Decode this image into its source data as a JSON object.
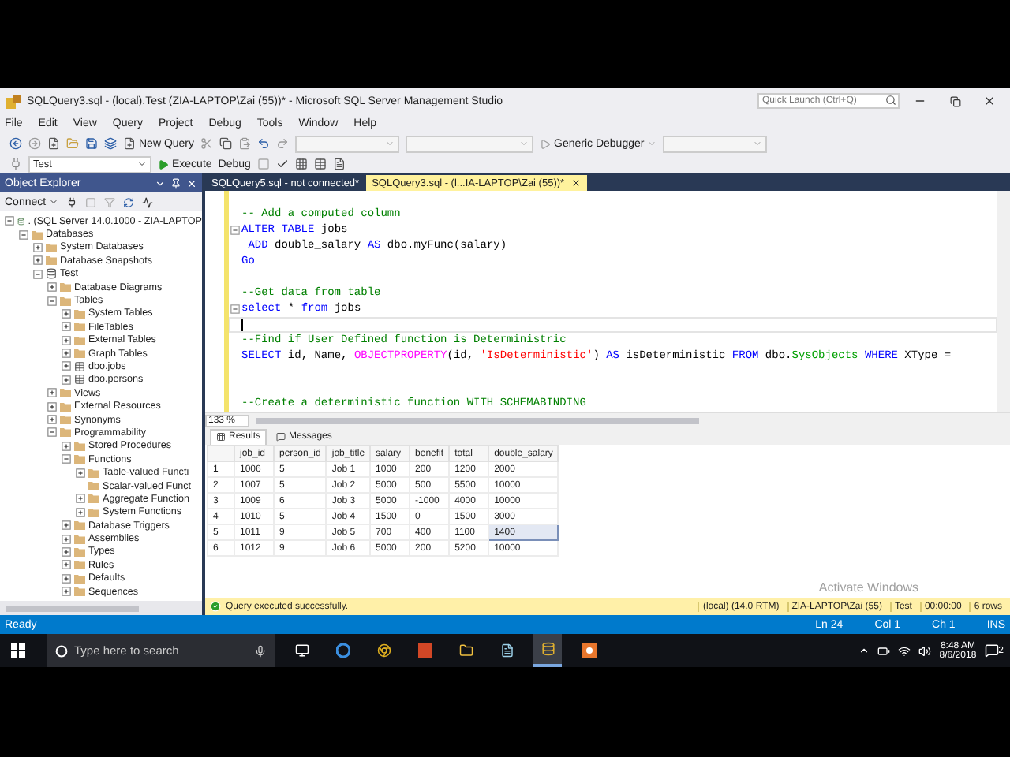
{
  "window": {
    "title": "SQLQuery3.sql - (local).Test (ZIA-LAPTOP\\Zai (55))* - Microsoft SQL Server Management Studio"
  },
  "quick_launch": {
    "placeholder": "Quick Launch (Ctrl+Q)"
  },
  "menu": [
    "File",
    "Edit",
    "View",
    "Query",
    "Project",
    "Debug",
    "Tools",
    "Window",
    "Help"
  ],
  "toolbar": {
    "new_query": "New Query",
    "debugger": "Generic Debugger",
    "database": "Test",
    "execute": "Execute",
    "debug": "Debug"
  },
  "object_explorer": {
    "title": "Object Explorer",
    "connect": "Connect",
    "tree": [
      {
        "label": ". (SQL Server 14.0.1000 - ZIA-LAPTOP",
        "kind": "server",
        "expanded": true,
        "children": [
          {
            "label": "Databases",
            "kind": "folder",
            "expanded": true,
            "children": [
              {
                "label": "System Databases",
                "kind": "folder",
                "expanded": false
              },
              {
                "label": "Database Snapshots",
                "kind": "folder",
                "expanded": false
              },
              {
                "label": "Test",
                "kind": "database",
                "expanded": true,
                "children": [
                  {
                    "label": "Database Diagrams",
                    "kind": "folder",
                    "expanded": false
                  },
                  {
                    "label": "Tables",
                    "kind": "folder",
                    "expanded": true,
                    "children": [
                      {
                        "label": "System Tables",
                        "kind": "folder",
                        "expanded": false
                      },
                      {
                        "label": "FileTables",
                        "kind": "folder",
                        "expanded": false
                      },
                      {
                        "label": "External Tables",
                        "kind": "folder",
                        "expanded": false
                      },
                      {
                        "label": "Graph Tables",
                        "kind": "folder",
                        "expanded": false
                      },
                      {
                        "label": "dbo.jobs",
                        "kind": "table",
                        "expanded": false
                      },
                      {
                        "label": "dbo.persons",
                        "kind": "table",
                        "expanded": false
                      }
                    ]
                  },
                  {
                    "label": "Views",
                    "kind": "folder",
                    "expanded": false
                  },
                  {
                    "label": "External Resources",
                    "kind": "folder",
                    "expanded": false
                  },
                  {
                    "label": "Synonyms",
                    "kind": "folder",
                    "expanded": false
                  },
                  {
                    "label": "Programmability",
                    "kind": "folder",
                    "expanded": true,
                    "children": [
                      {
                        "label": "Stored Procedures",
                        "kind": "folder",
                        "expanded": false
                      },
                      {
                        "label": "Functions",
                        "kind": "folder",
                        "expanded": true,
                        "children": [
                          {
                            "label": "Table-valued Functi",
                            "kind": "folder",
                            "expanded": false
                          },
                          {
                            "label": "Scalar-valued Funct",
                            "kind": "folder"
                          },
                          {
                            "label": "Aggregate Function",
                            "kind": "folder",
                            "expanded": false
                          },
                          {
                            "label": "System Functions",
                            "kind": "folder",
                            "expanded": false
                          }
                        ]
                      },
                      {
                        "label": "Database Triggers",
                        "kind": "folder",
                        "expanded": false
                      },
                      {
                        "label": "Assemblies",
                        "kind": "folder",
                        "expanded": false
                      },
                      {
                        "label": "Types",
                        "kind": "folder",
                        "expanded": false
                      },
                      {
                        "label": "Rules",
                        "kind": "folder",
                        "expanded": false
                      },
                      {
                        "label": "Defaults",
                        "kind": "folder",
                        "expanded": false
                      },
                      {
                        "label": "Sequences",
                        "kind": "folder",
                        "expanded": false
                      }
                    ]
                  }
                ]
              }
            ]
          }
        ]
      }
    ]
  },
  "editor_tabs": [
    {
      "label": "SQLQuery5.sql - not connected*",
      "selected": false
    },
    {
      "label": "SQLQuery3.sql - (l...IA-LAPTOP\\Zai (55))*",
      "selected": true
    }
  ],
  "code_lines": [
    {
      "fold": false,
      "current": false
    },
    {
      "fold": false,
      "current": false,
      "tokens": [
        {
          "kind": "comment",
          "text": "-- Add a computed column"
        }
      ]
    },
    {
      "fold": true,
      "current": false,
      "tokens": [
        {
          "kind": "keyword",
          "text": "ALTER TABLE"
        },
        {
          "kind": "plain",
          "text": " jobs"
        }
      ]
    },
    {
      "fold": false,
      "current": false,
      "tokens": [
        {
          "kind": "keyword",
          "text": " ADD"
        },
        {
          "kind": "plain",
          "text": " double_salary "
        },
        {
          "kind": "keyword",
          "text": "AS"
        },
        {
          "kind": "plain",
          "text": " dbo.myFunc(salary)"
        }
      ]
    },
    {
      "fold": false,
      "current": false,
      "tokens": [
        {
          "kind": "keyword",
          "text": "Go"
        }
      ]
    },
    {
      "fold": false,
      "current": false
    },
    {
      "fold": false,
      "current": false,
      "tokens": [
        {
          "kind": "comment",
          "text": "--Get data from table"
        }
      ]
    },
    {
      "fold": true,
      "current": false,
      "tokens": [
        {
          "kind": "keyword",
          "text": "select"
        },
        {
          "kind": "plain",
          "text": " * "
        },
        {
          "kind": "keyword",
          "text": "from"
        },
        {
          "kind": "plain",
          "text": " jobs"
        }
      ]
    },
    {
      "fold": false,
      "current": true
    },
    {
      "fold": false,
      "current": false,
      "tokens": [
        {
          "kind": "comment",
          "text": "--Find if User Defined function is Deterministric"
        }
      ]
    },
    {
      "fold": false,
      "current": false,
      "tokens": [
        {
          "kind": "keyword",
          "text": "SELECT"
        },
        {
          "kind": "plain",
          "text": " id, Name, "
        },
        {
          "kind": "function",
          "text": "OBJECTPROPERTY"
        },
        {
          "kind": "plain",
          "text": "(id, "
        },
        {
          "kind": "string",
          "text": "'IsDeterministic'"
        },
        {
          "kind": "plain",
          "text": ") "
        },
        {
          "kind": "keyword",
          "text": "AS"
        },
        {
          "kind": "plain",
          "text": " isDeterministic "
        },
        {
          "kind": "keyword",
          "text": "FROM"
        },
        {
          "kind": "plain",
          "text": " dbo."
        },
        {
          "kind": "system",
          "text": "SysObjects"
        },
        {
          "kind": "keyword",
          "text": " WHERE"
        },
        {
          "kind": "plain",
          "text": " XType ="
        }
      ]
    },
    {
      "fold": false,
      "current": false
    },
    {
      "fold": false,
      "current": false
    },
    {
      "fold": false,
      "current": false,
      "tokens": [
        {
          "kind": "comment",
          "text": "--Create a deterministic function WITH SCHEMABINDING"
        }
      ]
    }
  ],
  "zoom": "133 %",
  "result_tabs": [
    {
      "label": "Results",
      "selected": true
    },
    {
      "label": "Messages",
      "selected": false
    }
  ],
  "results": {
    "columns": [
      "job_id",
      "person_id",
      "job_title",
      "salary",
      "benefit",
      "total",
      "double_salary"
    ],
    "rows": [
      {
        "number": "1",
        "cells": [
          "1006",
          "5",
          "Job 1",
          "1000",
          "200",
          "1200",
          "2000"
        ],
        "selected": false
      },
      {
        "number": "2",
        "cells": [
          "1007",
          "5",
          "Job 2",
          "5000",
          "500",
          "5500",
          "10000"
        ],
        "selected": false
      },
      {
        "number": "3",
        "cells": [
          "1009",
          "6",
          "Job 3",
          "5000",
          "-1000",
          "4000",
          "10000"
        ],
        "selected": false
      },
      {
        "number": "4",
        "cells": [
          "1010",
          "5",
          "Job 4",
          "1500",
          "0",
          "1500",
          "3000"
        ],
        "selected": false
      },
      {
        "number": "5",
        "cells": [
          "1011",
          "9",
          "Job 5",
          "700",
          "400",
          "1100",
          "1400"
        ],
        "selected": true
      },
      {
        "number": "6",
        "cells": [
          "1012",
          "9",
          "Job 6",
          "5000",
          "200",
          "5200",
          "10000"
        ],
        "selected": false
      }
    ]
  },
  "query_status": {
    "message": "Query executed successfully.",
    "server": "(local) (14.0 RTM)",
    "user": "ZIA-LAPTOP\\Zai (55)",
    "database": "Test",
    "time": "00:00:00",
    "rows": "6 rows"
  },
  "activation_notice": "Activate Windows",
  "status_bar": {
    "text": "Ready",
    "line": "Ln 24",
    "column": "Col 1",
    "char": "Ch 1",
    "mode": "INS"
  },
  "taskbar": {
    "search_placeholder": "Type here to search",
    "time": "8:48 AM",
    "date": "8/6/2018",
    "notifications": "2"
  }
}
